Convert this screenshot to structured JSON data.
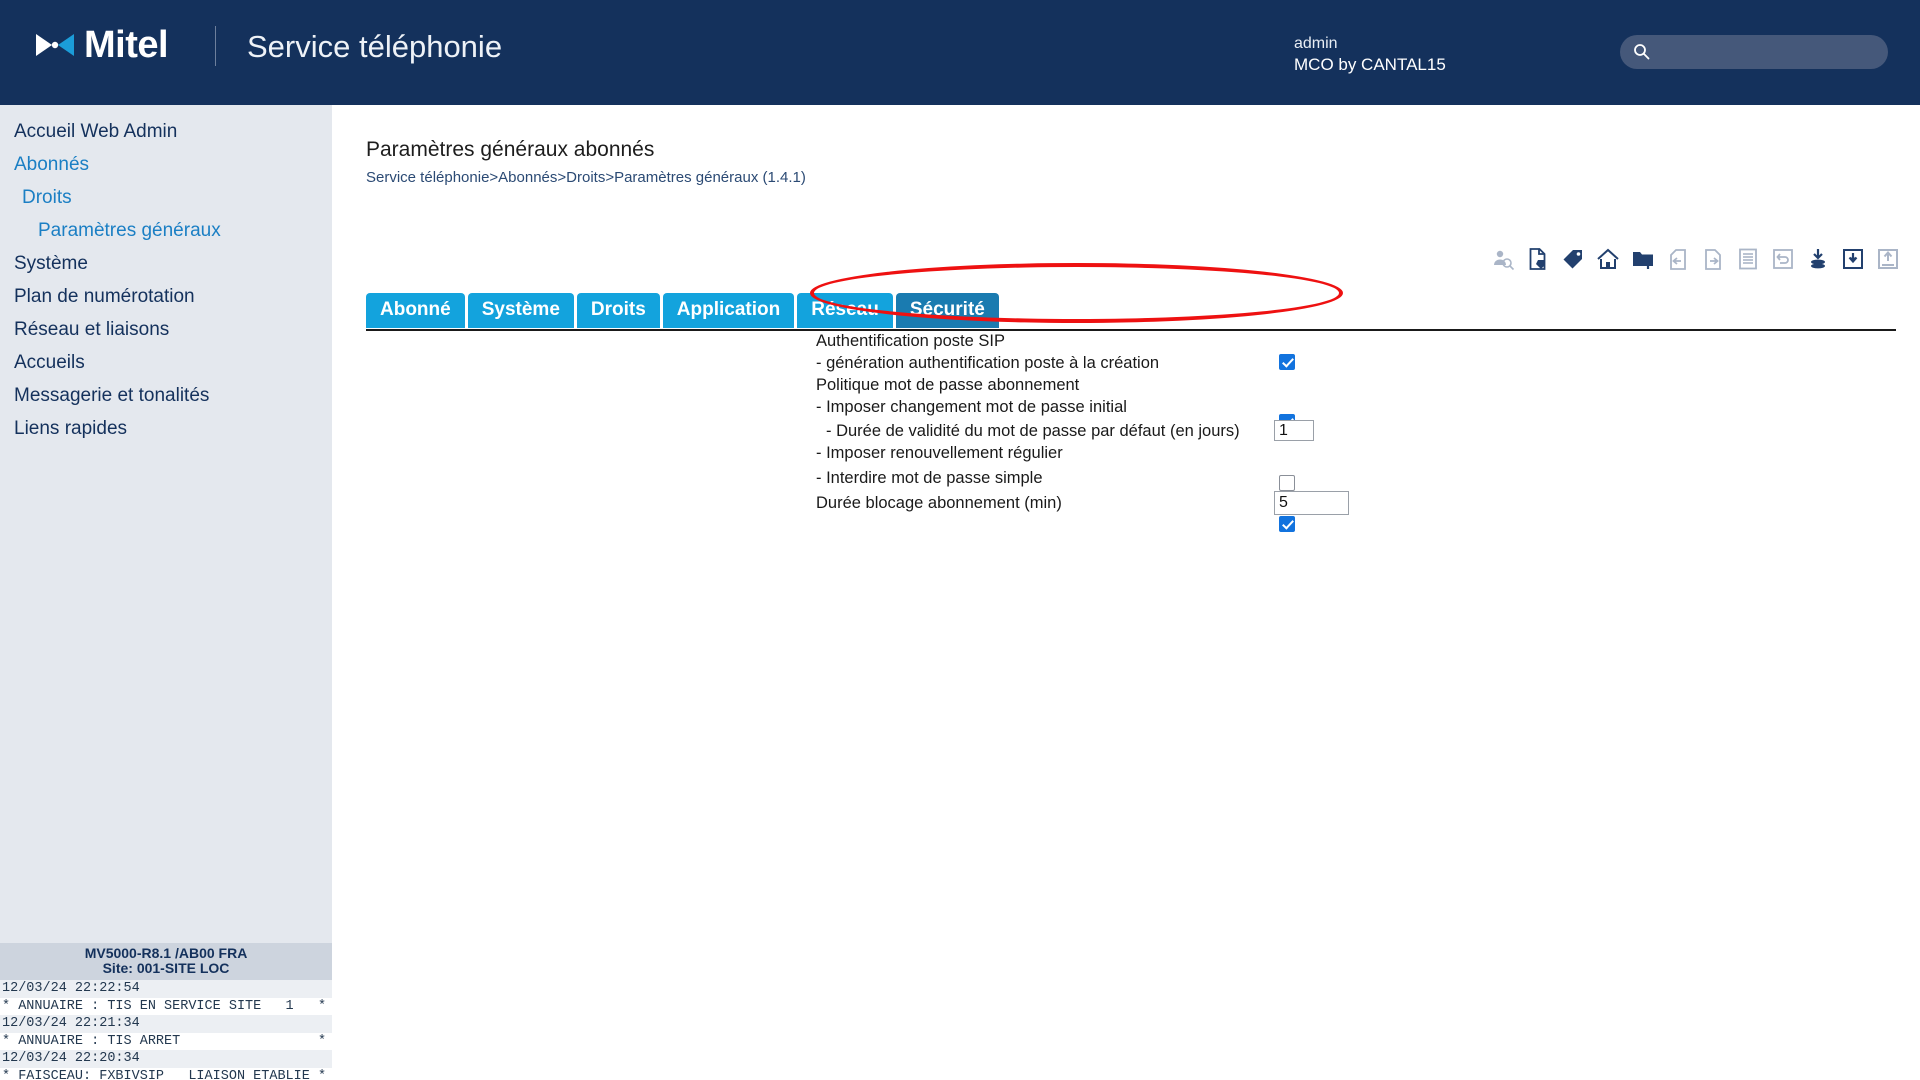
{
  "header": {
    "logo_text": "Mitel",
    "logo_icon": "mitel-bowtie-logo",
    "app_title": "Service téléphonie",
    "user_name": "admin",
    "user_org": "MCO by CANTAL15",
    "search_icon": "search-icon",
    "search_value": "",
    "search_placeholder": "",
    "bg_color": "#14315c",
    "accent_color": "#13a3dd"
  },
  "sidebar": {
    "bg_color": "#e4e8ee",
    "items": [
      {
        "label": "Accueil Web Admin",
        "level": 1,
        "style": "plain"
      },
      {
        "label": "Abonnés",
        "level": 1,
        "style": "link"
      },
      {
        "label": "Droits",
        "level": 2,
        "style": "link"
      },
      {
        "label": "Paramètres généraux",
        "level": 3,
        "style": "link"
      },
      {
        "label": "Système",
        "level": 1,
        "style": "plain"
      },
      {
        "label": "Plan de numérotation",
        "level": 1,
        "style": "plain"
      },
      {
        "label": "Réseau et liaisons",
        "level": 1,
        "style": "plain"
      },
      {
        "label": "Accueils",
        "level": 1,
        "style": "plain"
      },
      {
        "label": "Messagerie et tonalités",
        "level": 1,
        "style": "plain"
      },
      {
        "label": "Liens rapides",
        "level": 1,
        "style": "plain"
      }
    ]
  },
  "console": {
    "system": "MV5000-R8.1 /AB00 FRA",
    "site": "Site: 001-SITE LOC",
    "lines": [
      "12/03/24 22:22:54",
      "* ANNUAIRE : TIS EN SERVICE SITE   1   *",
      "12/03/24 22:21:34",
      "* ANNUAIRE : TIS ARRET                 *",
      "12/03/24 22:20:34",
      "* FAISCEAU: FXBIVSIP   LIAISON ETABLIE *"
    ]
  },
  "main": {
    "page_title": "Paramètres généraux abonnés",
    "breadcrumb": "Service téléphonie>Abonnés>Droits>Paramètres généraux (1.4.1)",
    "tabs": [
      {
        "label": "Abonné",
        "active": false
      },
      {
        "label": "Système",
        "active": false
      },
      {
        "label": "Droits",
        "active": false
      },
      {
        "label": "Application",
        "active": false
      },
      {
        "label": "Réseau",
        "active": false
      },
      {
        "label": "Sécurité",
        "active": true
      }
    ],
    "toolbar_icons": [
      {
        "name": "user-search-icon",
        "enabled": false
      },
      {
        "name": "document-tag-icon",
        "enabled": true
      },
      {
        "name": "tag-icon",
        "enabled": true
      },
      {
        "name": "home-icon",
        "enabled": true
      },
      {
        "name": "folder-upload-icon",
        "enabled": true
      },
      {
        "name": "previous-page-icon",
        "enabled": false
      },
      {
        "name": "next-page-icon",
        "enabled": false
      },
      {
        "name": "list-icon",
        "enabled": false
      },
      {
        "name": "refresh-icon",
        "enabled": false
      },
      {
        "name": "save-to-database-icon",
        "enabled": true
      },
      {
        "name": "save-icon",
        "enabled": true
      },
      {
        "name": "restore-icon",
        "enabled": false
      }
    ],
    "form": {
      "section_auth_title": "Authentification poste SIP",
      "row_generation_label": "- génération authentification poste à la création",
      "row_generation_checked": true,
      "section_password_title": "Politique mot de passe abonnement",
      "row_initial_label": "- Imposer changement mot de passe initial",
      "row_initial_checked": true,
      "row_validity_label": "- Durée de validité du mot de passe par défaut (en jours)",
      "row_validity_value": "1",
      "row_renewal_label": "- Imposer renouvellement régulier",
      "row_renewal_checked": false,
      "row_simple_label": "- Interdire mot de passe simple",
      "row_simple_checked": true,
      "row_lock_label": "Durée blocage abonnement (min)",
      "row_lock_value": "5"
    },
    "annotation": {
      "name": "red-highlight-oval",
      "color": "#ee1111",
      "targets": "Politique mot de passe abonnement / - Imposer changement mot de passe initial"
    }
  }
}
